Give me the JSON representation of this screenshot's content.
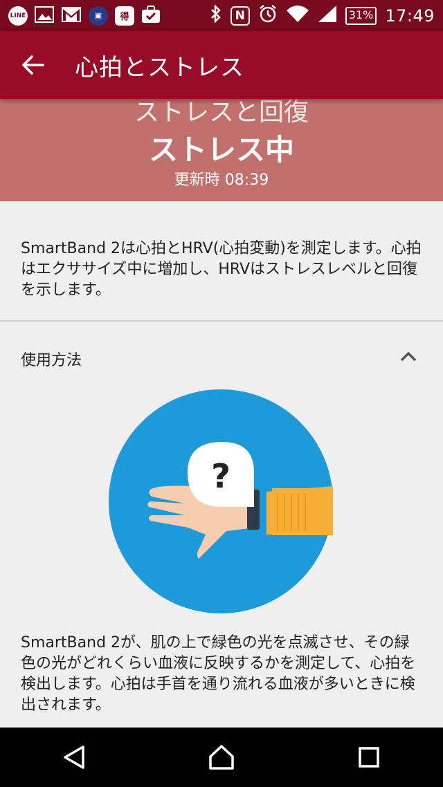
{
  "status_bar": {
    "icons": [
      "line-icon",
      "gallery-icon",
      "gmail-icon",
      "app-icon",
      "toku-icon",
      "briefcase-icon",
      "bluetooth-icon",
      "nfc-icon",
      "alarm-icon",
      "wifi-icon",
      "signal-icon"
    ],
    "line_label": "LINE",
    "toku_label": "得",
    "nfc_label": "N",
    "battery": "31%",
    "time": "17:49"
  },
  "app_bar": {
    "back_icon": "arrow-left-icon",
    "title": "心拍とストレス"
  },
  "hero": {
    "subtitle": "ストレスと回復",
    "status": "ストレス中",
    "updated": "更新時 08:39"
  },
  "description": "SmartBand 2は心拍とHRV(心拍変動)を測定します。心拍はエクササイズ中に増加し、HRVはストレスレベルと回復を示します。",
  "usage": {
    "heading": "使用方法",
    "toggle_icon": "chevron-up-icon",
    "illustration": {
      "icon": "wrist-band-illustration",
      "question_mark": "?"
    },
    "text": "SmartBand 2が、肌の上で緑色の光を点滅させ、その緑色の光がどれくらい血液に反映するかを測定して、心拍を検出します。心拍は手首を通り流れる血液が多いときに検出されます。"
  },
  "nav_bar": {
    "back": "nav-back-icon",
    "home": "nav-home-icon",
    "recents": "nav-recents-icon"
  },
  "colors": {
    "status_bar": "#780a1f",
    "app_bar": "#960c28",
    "hero": "#c1706e",
    "illustration_circle": "#1e9ad9",
    "sleeve": "#f6b036"
  }
}
